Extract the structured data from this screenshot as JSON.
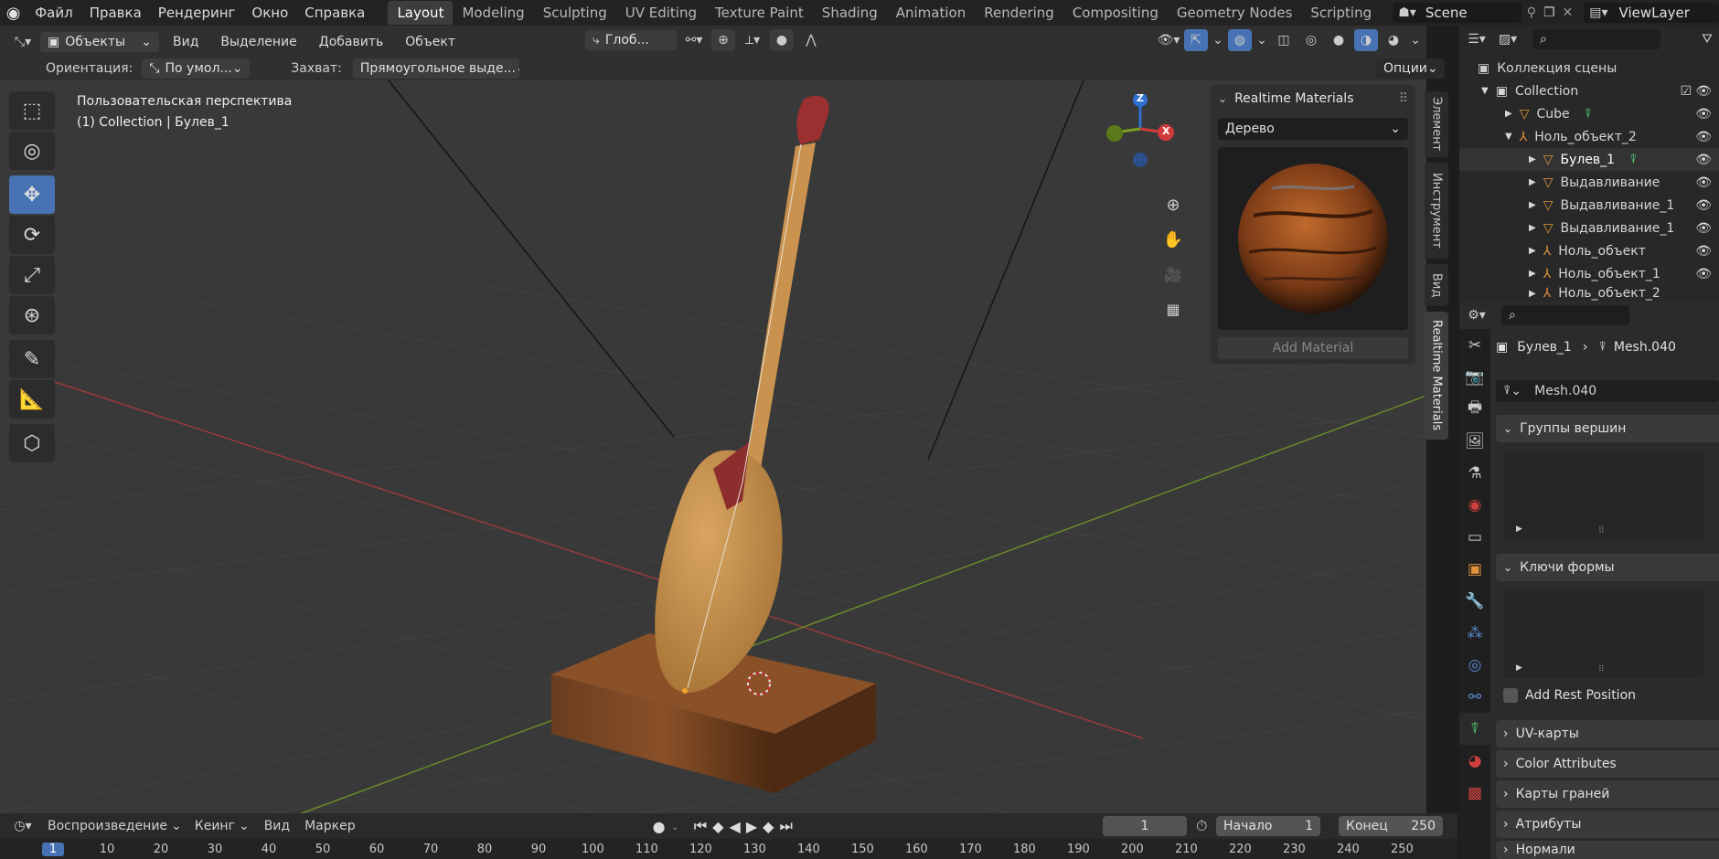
{
  "topbar": {
    "menus": [
      "Файл",
      "Правка",
      "Рендеринг",
      "Окно",
      "Справка"
    ],
    "workspaces": [
      "Layout",
      "Modeling",
      "Sculpting",
      "UV Editing",
      "Texture Paint",
      "Shading",
      "Animation",
      "Rendering",
      "Compositing",
      "Geometry Nodes",
      "Scripting"
    ],
    "active_workspace": "Layout",
    "scene": "Scene",
    "view_layer": "ViewLayer"
  },
  "header": {
    "mode": "Объекты",
    "menus": [
      "Вид",
      "Выделение",
      "Добавить",
      "Объект"
    ],
    "transform": "Глоб...",
    "orientation_label": "Ориентация:",
    "orientation_value": "По умол...",
    "snap_label": "Захват:",
    "snap_value": "Прямоугольное выде...",
    "options": "Опции"
  },
  "viewport": {
    "view_name": "Пользовательская перспектива",
    "object_info": "(1) Collection | Булев_1"
  },
  "nav": {
    "x": "X",
    "z": "Z"
  },
  "ntabs": [
    "Элемент",
    "Инструмент",
    "Вид",
    "Realtime Materials"
  ],
  "realtime_materials": {
    "title": "Realtime Materials",
    "category": "Дерево",
    "add_button": "Add Material"
  },
  "outliner": {
    "search_placeholder": "",
    "rows": [
      {
        "label": "Коллекция сцены",
        "level": 0
      },
      {
        "label": "Collection",
        "level": 1
      },
      {
        "label": "Cube",
        "level": 2
      },
      {
        "label": "Ноль_объект_2",
        "level": 2
      },
      {
        "label": "Булев_1",
        "level": 3
      },
      {
        "label": "Выдавливание",
        "level": 3
      },
      {
        "label": "Выдавливание_1",
        "level": 3
      },
      {
        "label": "Выдавливание_1",
        "level": 3
      },
      {
        "label": "Ноль_объект",
        "level": 3
      },
      {
        "label": "Ноль_объект_1",
        "level": 3
      },
      {
        "label": "Ноль_объект_2",
        "level": 3
      }
    ]
  },
  "properties": {
    "breadcrumb_object": "Булев_1",
    "breadcrumb_mesh": "Mesh.040",
    "mesh_name": "Mesh.040",
    "sections": {
      "vertex_groups": "Группы вершин",
      "shape_keys": "Ключи формы",
      "add_rest_position": "Add Rest Position",
      "uv_maps": "UV-карты",
      "color_attributes": "Color Attributes",
      "face_maps": "Карты граней",
      "attributes": "Атрибуты",
      "normals": "Нормали"
    }
  },
  "timeline": {
    "playback": "Воспроизведение",
    "keying": "Кеинг",
    "view": "Вид",
    "marker": "Маркер",
    "current_frame": "1",
    "start_label": "Начало",
    "start_value": "1",
    "end_label": "Конец",
    "end_value": "250",
    "ticks": [
      "1",
      "10",
      "20",
      "30",
      "40",
      "50",
      "60",
      "70",
      "80",
      "90",
      "100",
      "110",
      "120",
      "130",
      "140",
      "150",
      "160",
      "170",
      "180",
      "190",
      "200",
      "210",
      "220",
      "230",
      "240",
      "250"
    ]
  },
  "colors": {
    "accent": "#4772b3",
    "viewport": "#393939",
    "panel": "#303030"
  }
}
